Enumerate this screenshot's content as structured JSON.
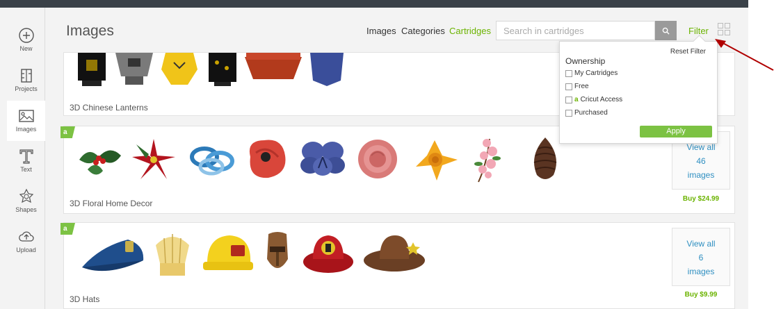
{
  "sidebar": {
    "items": [
      {
        "label": "New",
        "icon": "plus-circle-icon"
      },
      {
        "label": "Projects",
        "icon": "projects-icon"
      },
      {
        "label": "Images",
        "icon": "image-icon"
      },
      {
        "label": "Text",
        "icon": "text-icon"
      },
      {
        "label": "Shapes",
        "icon": "shapes-icon"
      },
      {
        "label": "Upload",
        "icon": "upload-cloud-icon"
      }
    ],
    "active": "Images"
  },
  "header": {
    "title": "Images",
    "nav": [
      "Images",
      "Categories",
      "Cartridges"
    ],
    "active_nav": "Cartridges",
    "search_placeholder": "Search in cartridges",
    "filter_label": "Filter"
  },
  "filter": {
    "reset_label": "Reset Filter",
    "section": "Ownership",
    "options": [
      "My Cartridges",
      "Free",
      "Cricut Access",
      "Purchased"
    ],
    "apply_label": "Apply"
  },
  "cartridges": [
    {
      "title": "3D Chinese Lanterns"
    },
    {
      "title": "3D Floral Home Decor",
      "view_all": [
        "View all",
        "46",
        "images"
      ],
      "price": "Buy $24.99"
    },
    {
      "title": "3D Hats",
      "view_all": [
        "View all",
        "6",
        "images"
      ],
      "price": "Buy $9.99"
    }
  ],
  "colors": {
    "accent_green": "#6bb300",
    "link_blue": "#2f8fc1",
    "annotation_red": "#b00000"
  }
}
